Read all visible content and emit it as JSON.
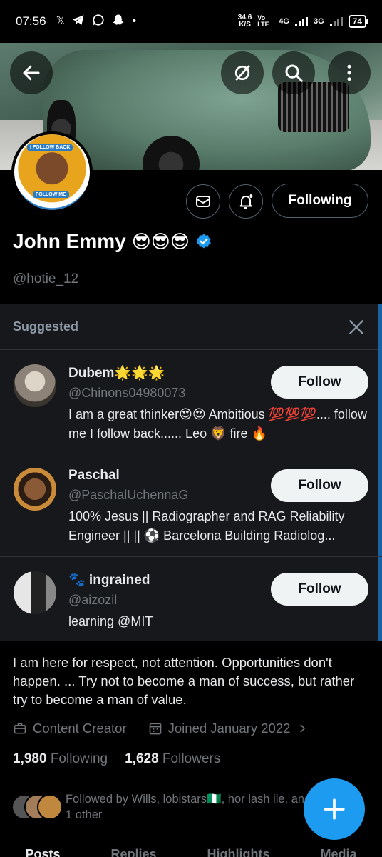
{
  "status_bar": {
    "time": "07:56",
    "net_speed_value": "34.6",
    "net_speed_unit": "K/S",
    "volte": "Vo LTE",
    "sim1": "4G",
    "sim2": "3G",
    "battery": "74"
  },
  "profile": {
    "name": "John Emmy",
    "name_emojis": "😎😎😎",
    "handle": "@hotie_12",
    "following_label": "Following",
    "avatar_tags": [
      "I FOLLOW BACK",
      "FOLLOW ME"
    ],
    "bio": "I am here for respect, not attention. Opportunities don't happen. ... Try not to become a man of success, but rather try to become a man of value.",
    "category": "Content Creator",
    "joined": "Joined January 2022",
    "following_count": "1,980",
    "following_label_text": "Following",
    "followers_count": "1,628",
    "followers_label_text": "Followers",
    "followed_by": "Followed by Wills, lobistars🇳🇬, hor lash ile, and 1 other"
  },
  "suggested": {
    "title": "Suggested",
    "items": [
      {
        "name": "Dubem🌟🌟🌟",
        "handle": "@Chinons04980073",
        "bio": "I am a great thinker😍😍 Ambitious 💯💯💯.... follow me I follow back...... Leo 🦁 fire 🔥",
        "button": "Follow"
      },
      {
        "name": "Paschal",
        "handle": "@PaschalUchennaG",
        "bio": "100% Jesus || Radiographer and RAG Reliability Engineer || || ⚽ Barcelona Building Radiolog...",
        "button": "Follow"
      },
      {
        "name": "🐾 ingrained",
        "handle": "@aizozil",
        "bio": "learning @MIT",
        "button": "Follow"
      }
    ]
  },
  "tabs": [
    "Posts",
    "Replies",
    "Highlights",
    "Media"
  ],
  "colors": {
    "accent": "#1d9bf0",
    "background": "#000000",
    "panel": "#16181c",
    "muted": "#71767b"
  }
}
